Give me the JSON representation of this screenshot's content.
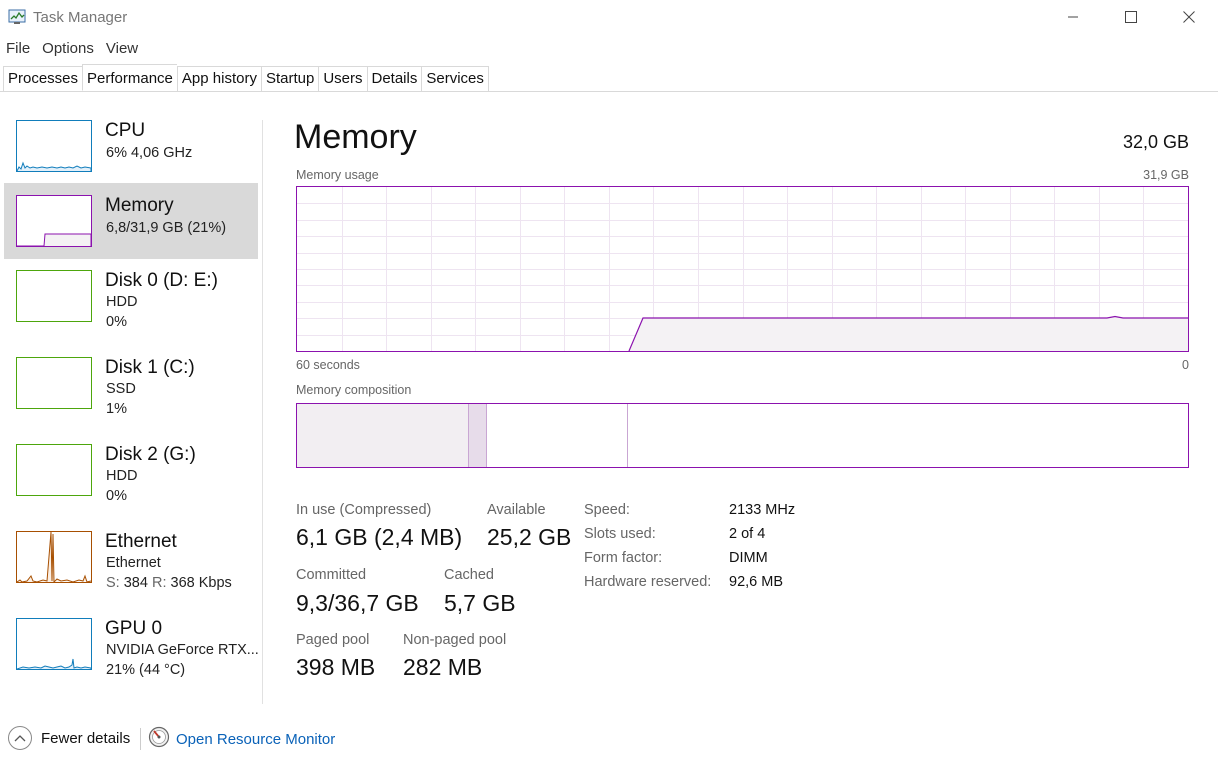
{
  "window": {
    "title": "Task Manager",
    "icon": "task-manager-icon"
  },
  "menu": [
    "File",
    "Options",
    "View"
  ],
  "tabs": [
    {
      "label": "Processes"
    },
    {
      "label": "Performance"
    },
    {
      "label": "App history"
    },
    {
      "label": "Startup"
    },
    {
      "label": "Users"
    },
    {
      "label": "Details"
    },
    {
      "label": "Services"
    }
  ],
  "active_tab": "Performance",
  "sidebar": {
    "items": [
      {
        "name": "CPU",
        "line1": "6%  4,06 GHz",
        "color": "#117dbb"
      },
      {
        "name": "Memory",
        "line1": "6,8/31,9 GB (21%)",
        "color": "#8b12ae",
        "selected": true
      },
      {
        "name": "Disk 0 (D: E:)",
        "line1": "HDD",
        "line2": "0%",
        "color": "#4da60c"
      },
      {
        "name": "Disk 1 (C:)",
        "line1": "SSD",
        "line2": "1%",
        "color": "#4da60c"
      },
      {
        "name": "Disk 2 (G:)",
        "line1": "HDD",
        "line2": "0%",
        "color": "#4da60c"
      },
      {
        "name": "Ethernet",
        "line1": "Ethernet",
        "line2_s_label": "S:",
        "line2_s": "384",
        "line2_r_label": "R:",
        "line2_r": "368 Kbps",
        "color": "#a74f01"
      },
      {
        "name": "GPU 0",
        "line1": "NVIDIA GeForce RTX...",
        "line2": "21% (44 °C)",
        "color": "#117dbb"
      }
    ]
  },
  "main": {
    "title": "Memory",
    "total": "32,0 GB",
    "usage_label": "Memory usage",
    "usage_max": "31,9 GB",
    "time_left": "60 seconds",
    "time_right": "0",
    "composition_label": "Memory composition",
    "graph_color": "#8b12ae",
    "stats": {
      "in_use_label": "In use (Compressed)",
      "in_use_value": "6,1 GB (2,4 MB)",
      "available_label": "Available",
      "available_value": "25,2 GB",
      "committed_label": "Committed",
      "committed_value": "9,3/36,7 GB",
      "cached_label": "Cached",
      "cached_value": "5,7 GB",
      "paged_label": "Paged pool",
      "paged_value": "398 MB",
      "nonpaged_label": "Non-paged pool",
      "nonpaged_value": "282 MB"
    },
    "specs": [
      {
        "label": "Speed:",
        "value": "2133 MHz"
      },
      {
        "label": "Slots used:",
        "value": "2 of 4"
      },
      {
        "label": "Form factor:",
        "value": "DIMM"
      },
      {
        "label": "Hardware reserved:",
        "value": "92,6 MB"
      }
    ]
  },
  "footer": {
    "fewer_details": "Fewer details",
    "open_resource_monitor": "Open Resource Monitor"
  }
}
